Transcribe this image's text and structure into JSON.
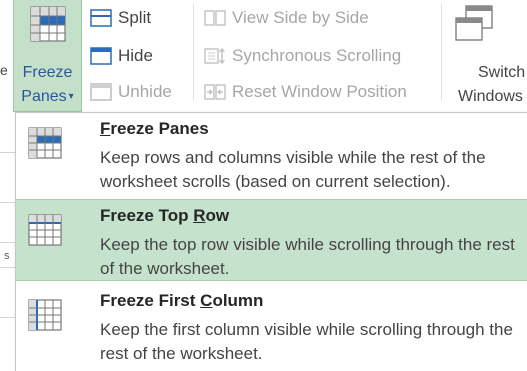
{
  "ribbon": {
    "cut_text": "e",
    "freeze_panes": {
      "line1": "Freeze",
      "line2": "Panes"
    },
    "split": {
      "label": "Split"
    },
    "hide": {
      "label": "Hide"
    },
    "unhide": {
      "label": "Unhide"
    },
    "view_side_by_side": {
      "label": "View Side by Side"
    },
    "synchronous_scrolling": {
      "label": "Synchronous Scrolling"
    },
    "reset_window_position": {
      "label": "Reset Window Position"
    },
    "switch_windows": {
      "line1": "Switch",
      "line2": "Windows"
    }
  },
  "menu": {
    "items": [
      {
        "title_before": "",
        "title_key": "F",
        "title_after": "reeze Panes",
        "description": "Keep rows and columns visible while the rest of the worksheet scrolls (based on current selection).",
        "icon": "freeze-panes-icon"
      },
      {
        "title_before": "Freeze Top ",
        "title_key": "R",
        "title_after": "ow",
        "description": "Keep the top row visible while scrolling through the rest of the worksheet.",
        "icon": "freeze-top-row-icon"
      },
      {
        "title_before": "Freeze First ",
        "title_key": "C",
        "title_after": "olumn",
        "description": "Keep the first column visible while scrolling through the rest of the worksheet.",
        "icon": "freeze-first-column-icon"
      }
    ]
  },
  "sheet_edge_glyph": "s",
  "colors": {
    "active_green": "#c5e2cd",
    "freeze_button_green": "#c5e0c9",
    "accent_blue": "#2b579a"
  }
}
